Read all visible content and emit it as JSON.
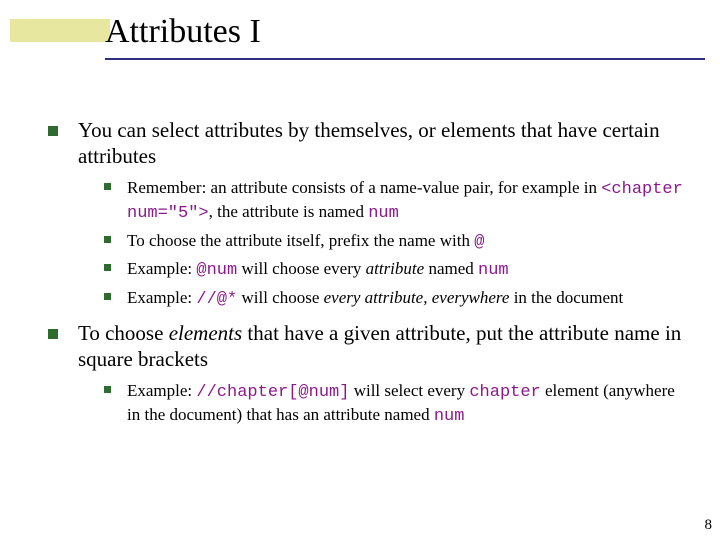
{
  "title": "Attributes I",
  "bullets": {
    "b1": "You can select attributes by themselves, or elements that have certain attributes",
    "b1_sub": {
      "s1a": "Remember: an attribute consists of a name-value pair, for example in ",
      "s1_code": "<chapter num=\"5\">",
      "s1b": ", the attribute is named ",
      "s1_code2": "num",
      "s2a": "To choose the attribute itself, prefix the name with ",
      "s2_code": "@",
      "s3a": "Example: ",
      "s3_code": "@num",
      "s3b": " will choose every ",
      "s3_attr": "attribute",
      "s3c": " named ",
      "s3_code2": "num",
      "s4a": "Example: ",
      "s4_code": "//@*",
      "s4b": " will choose ",
      "s4_every": "every attribute, everywhere",
      "s4c": " in the document"
    },
    "b2a": "To choose ",
    "b2_elements": "elements",
    "b2b": " that have a given attribute, put the attribute name in square brackets",
    "b2_sub": {
      "s1a": "Example: ",
      "s1_code": "//chapter[@num]",
      "s1b": " will select every ",
      "s1_code2": "chapter",
      "s1c": " element (anywhere in the document) that has an attribute named ",
      "s1_code3": "num"
    }
  },
  "page_number": "8"
}
